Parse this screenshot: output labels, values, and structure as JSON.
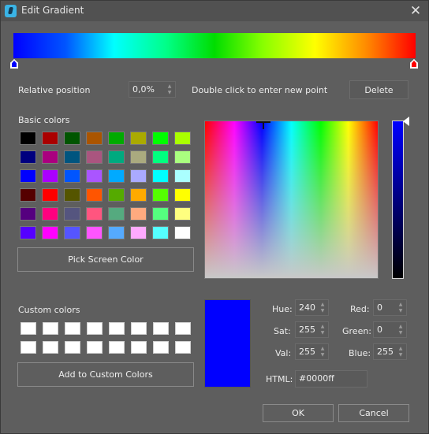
{
  "window": {
    "title": "Edit Gradient",
    "app_icon": "app-icon",
    "close_icon": "close-icon",
    "close_glyph": "✕"
  },
  "gradient": {
    "colors": [
      "#0000ff",
      "#00ffff",
      "#00dd00",
      "#ffff00",
      "#ff0000"
    ],
    "stops": [
      {
        "position_percent": 0,
        "color": "#0000ff",
        "selected": true
      },
      {
        "position_percent": 100,
        "color": "#ff0000",
        "selected": false
      }
    ]
  },
  "position_row": {
    "label": "Relative position",
    "value": "0,0%",
    "hint": "Double click to enter new point",
    "delete_label": "Delete"
  },
  "basic_colors": {
    "label": "Basic colors",
    "rows": [
      [
        "#000000",
        "#aa0000",
        "#005500",
        "#aa5500",
        "#00aa00",
        "#aaaa00",
        "#00ff00",
        "#aaff00"
      ],
      [
        "#00007f",
        "#aa007f",
        "#00557f",
        "#aa557f",
        "#00aa7f",
        "#aaaa7f",
        "#00ff7f",
        "#aaff7f"
      ],
      [
        "#0000ff",
        "#aa00ff",
        "#0055ff",
        "#aa55ff",
        "#00aaff",
        "#aaaaff",
        "#00ffff",
        "#aaffff"
      ],
      [
        "#550000",
        "#ff0000",
        "#555500",
        "#ff5500",
        "#55aa00",
        "#ffaa00",
        "#55ff00",
        "#ffff00"
      ],
      [
        "#55007f",
        "#ff007f",
        "#55557f",
        "#ff557f",
        "#55aa7f",
        "#ffaa7f",
        "#55ff7f",
        "#ffff7f"
      ],
      [
        "#5500ff",
        "#ff00ff",
        "#5555ff",
        "#ff55ff",
        "#55aaff",
        "#ffaaff",
        "#55ffff",
        "#ffffff"
      ]
    ],
    "pick_screen_label": "Pick Screen Color"
  },
  "custom_colors": {
    "label": "Custom colors",
    "colors": [
      "#ffffff",
      "#ffffff",
      "#ffffff",
      "#ffffff",
      "#ffffff",
      "#ffffff",
      "#ffffff",
      "#ffffff",
      "#ffffff",
      "#ffffff",
      "#ffffff",
      "#ffffff",
      "#ffffff",
      "#ffffff",
      "#ffffff",
      "#ffffff"
    ],
    "add_label": "Add to Custom Colors"
  },
  "current_color": {
    "preview": "#0000ff",
    "hue_label": "Hue:",
    "hue": "240",
    "sat_label": "Sat:",
    "sat": "255",
    "val_label": "Val:",
    "val": "255",
    "red_label": "Red:",
    "red": "0",
    "green_label": "Green:",
    "green": "0",
    "blue_label": "Blue:",
    "blue": "255",
    "html_label": "HTML:",
    "html": "#0000ff"
  },
  "footer": {
    "ok_label": "OK",
    "cancel_label": "Cancel"
  }
}
